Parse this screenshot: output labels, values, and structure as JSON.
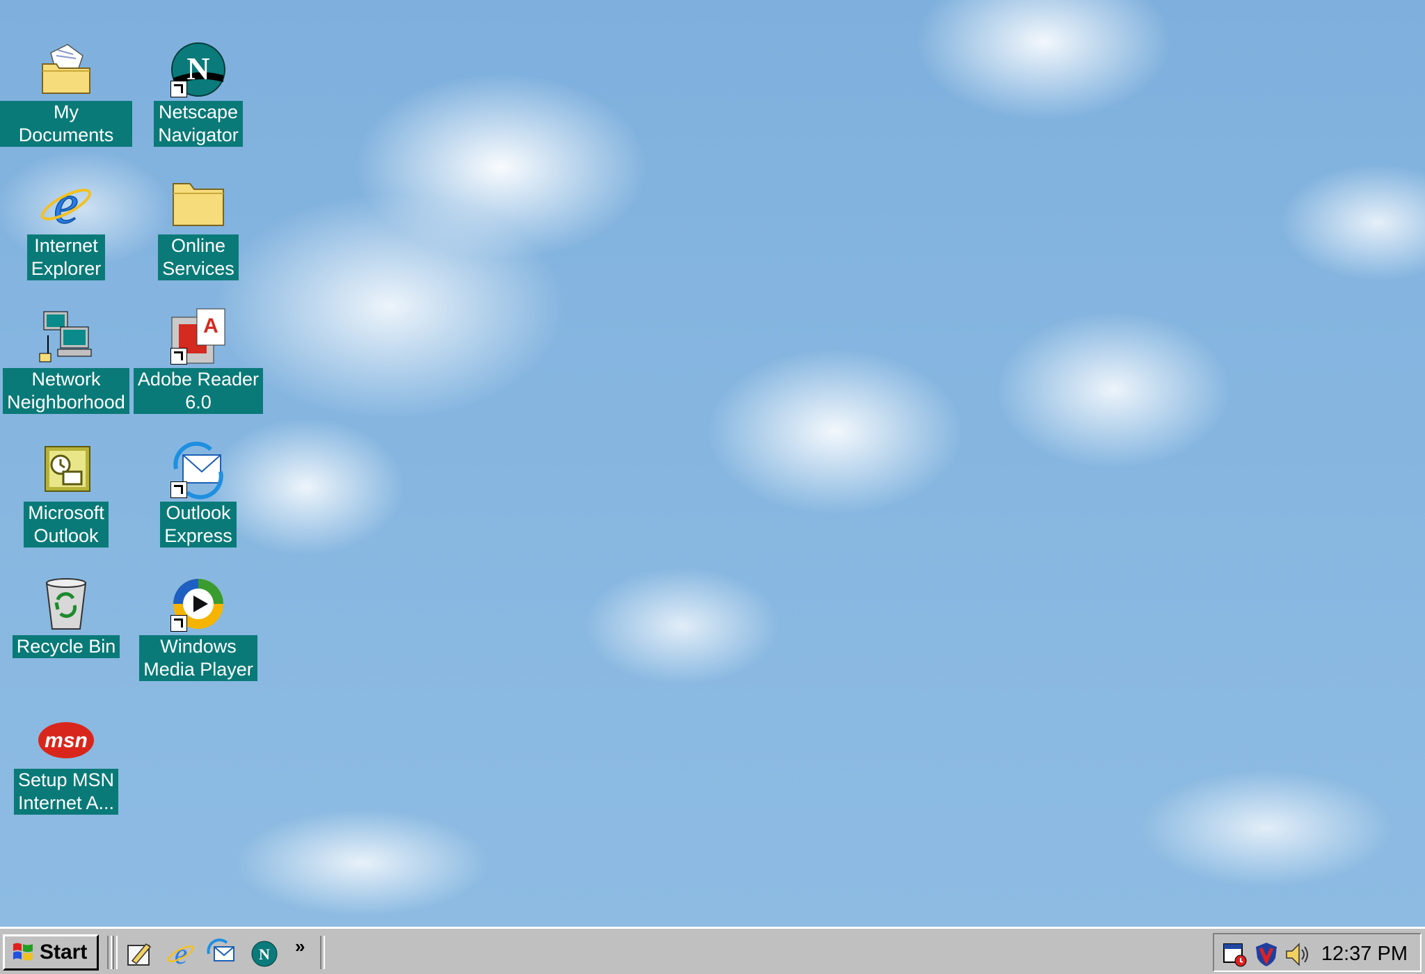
{
  "desktop": {
    "icons": [
      {
        "label": "My Documents",
        "icon": "folder-documents-icon"
      },
      {
        "label": "Netscape\nNavigator",
        "icon": "netscape-icon"
      },
      {
        "label": "Internet\nExplorer",
        "icon": "internet-explorer-icon"
      },
      {
        "label": "Online\nServices",
        "icon": "folder-icon"
      },
      {
        "label": "Network\nNeighborhood",
        "icon": "network-computers-icon"
      },
      {
        "label": "Adobe Reader\n6.0",
        "icon": "adobe-reader-icon"
      },
      {
        "label": "Microsoft\nOutlook",
        "icon": "outlook-icon"
      },
      {
        "label": "Outlook\nExpress",
        "icon": "outlook-express-icon"
      },
      {
        "label": "Recycle Bin",
        "icon": "recycle-bin-icon"
      },
      {
        "label": "Windows\nMedia Player",
        "icon": "media-player-icon"
      },
      {
        "label": "Setup MSN\nInternet A...",
        "icon": "msn-icon"
      }
    ],
    "msn_logo_text": "msn"
  },
  "taskbar": {
    "start_label": "Start",
    "quick_launch": [
      "show-desktop-icon",
      "internet-explorer-icon",
      "outlook-express-icon",
      "netscape-icon"
    ],
    "more_label": "»",
    "tray_icons": [
      "task-scheduler-icon",
      "antivirus-shield-icon",
      "volume-icon"
    ],
    "clock": "12:37 PM"
  },
  "colors": {
    "label_background": "#0a7a78",
    "taskbar": "#c0c0c0"
  }
}
